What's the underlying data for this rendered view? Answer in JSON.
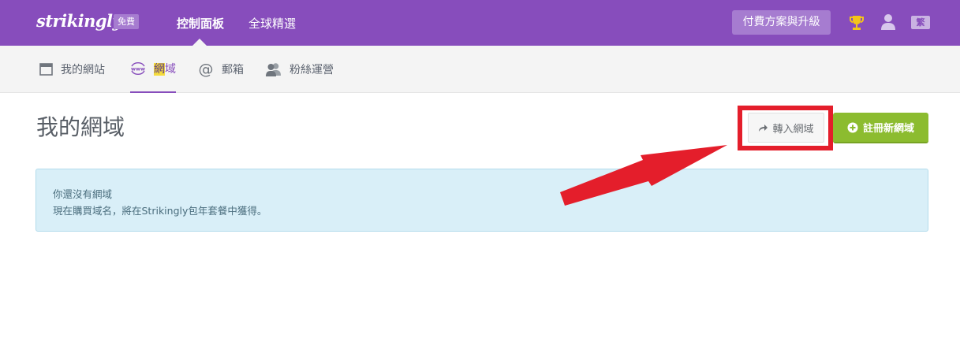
{
  "header": {
    "logo": "strikingly",
    "plan_badge": "免費",
    "nav": [
      "控制面板",
      "全球精選"
    ],
    "upgrade_label": "付費方案與升級",
    "lang_label": "繁"
  },
  "tabs": [
    {
      "label": "我的網站",
      "icon": "browser-window-icon"
    },
    {
      "label_highlight": "網",
      "label_rest": "域",
      "icon": "www-globe-icon"
    },
    {
      "label": "郵箱",
      "icon": "at-sign-icon"
    },
    {
      "label": "粉絲運營",
      "icon": "people-icon"
    }
  ],
  "main": {
    "title": "我的網域",
    "transfer_label": "轉入網域",
    "register_label": "註冊新網域",
    "info_line1": "你還沒有網域",
    "info_line2": "現在購買域名，將在Strikingly包年套餐中獲得。"
  },
  "colors": {
    "brand_purple": "#874dbc",
    "register_green": "#8cbc2f",
    "annotation_red": "#e41e2b"
  }
}
